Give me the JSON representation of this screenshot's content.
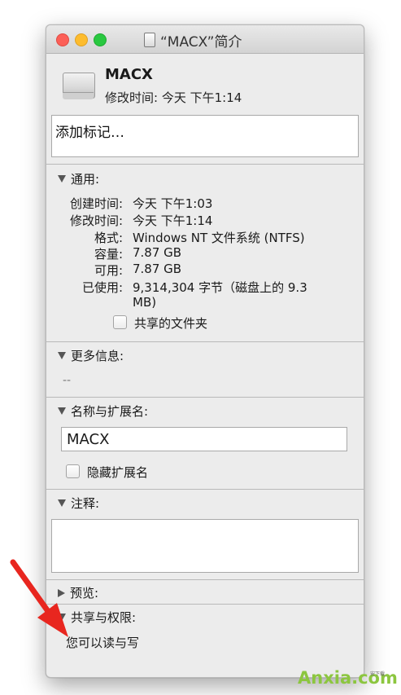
{
  "window": {
    "title": "“MACX”简介"
  },
  "header": {
    "name": "MACX",
    "modified_label": "修改时间:",
    "modified_value": "今天 下午1:14"
  },
  "tags": {
    "placeholder": "添加标记…"
  },
  "general": {
    "heading": "通用:",
    "rows": [
      {
        "label": "创建时间:",
        "value": "今天 下午1:03"
      },
      {
        "label": "修改时间:",
        "value": "今天 下午1:14"
      },
      {
        "label": "格式:",
        "value": "Windows NT 文件系统 (NTFS)"
      },
      {
        "label": "容量:",
        "value": "7.87 GB"
      },
      {
        "label": "可用:",
        "value": "7.87 GB"
      },
      {
        "label": "已使用:",
        "value": "9,314,304 字节（磁盘上的 9.3"
      },
      {
        "label": "",
        "value": "MB)"
      }
    ],
    "shared_folder_label": "共享的文件夹",
    "shared_folder_checked": false
  },
  "more_info": {
    "heading": "更多信息:",
    "value": "--"
  },
  "name_ext": {
    "heading": "名称与扩展名:",
    "name_value": "MACX",
    "hide_ext_label": "隐藏扩展名",
    "hide_ext_checked": false
  },
  "comments": {
    "heading": "注释:"
  },
  "preview": {
    "heading": "预览:"
  },
  "sharing": {
    "heading": "共享与权限:",
    "permission_text": "您可以读与写"
  },
  "watermark": {
    "brand": "Anxia.com",
    "tagline": "安下载"
  },
  "colors": {
    "close": "#fc5f57",
    "minimize": "#fdbc2e",
    "zoom": "#29c840",
    "arrow": "#e8261f",
    "watermark": "#8cc63f"
  }
}
